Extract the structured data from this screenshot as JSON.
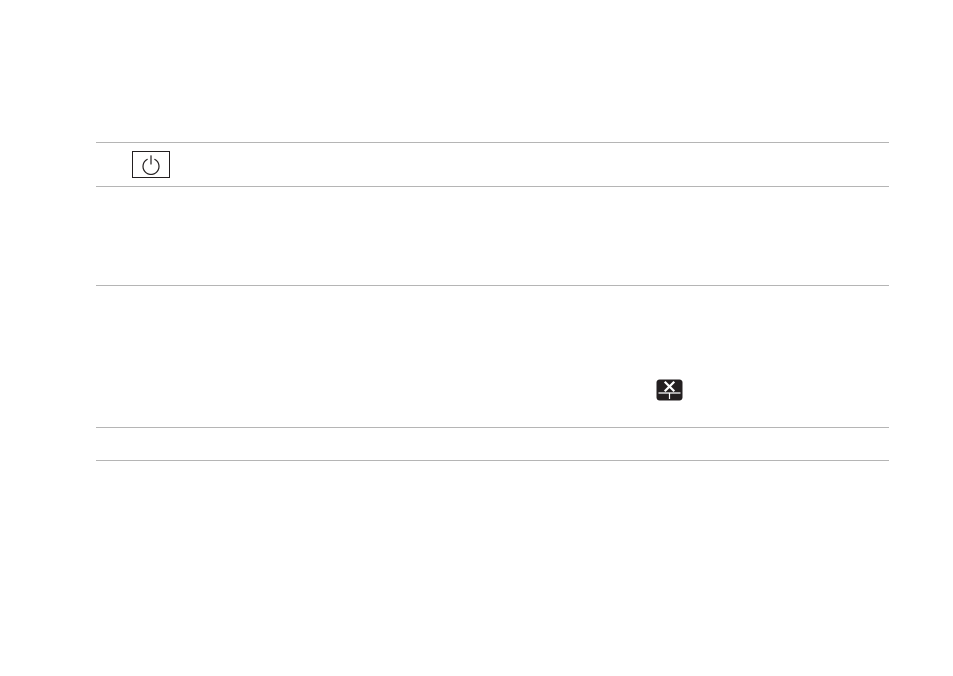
{
  "icons": {
    "power": "power-icon",
    "touchpad_toggle": "touchpad-disable-icon"
  },
  "colors": {
    "text": "#231f20",
    "rule": "#b5b5b5",
    "background": "#ffffff"
  }
}
